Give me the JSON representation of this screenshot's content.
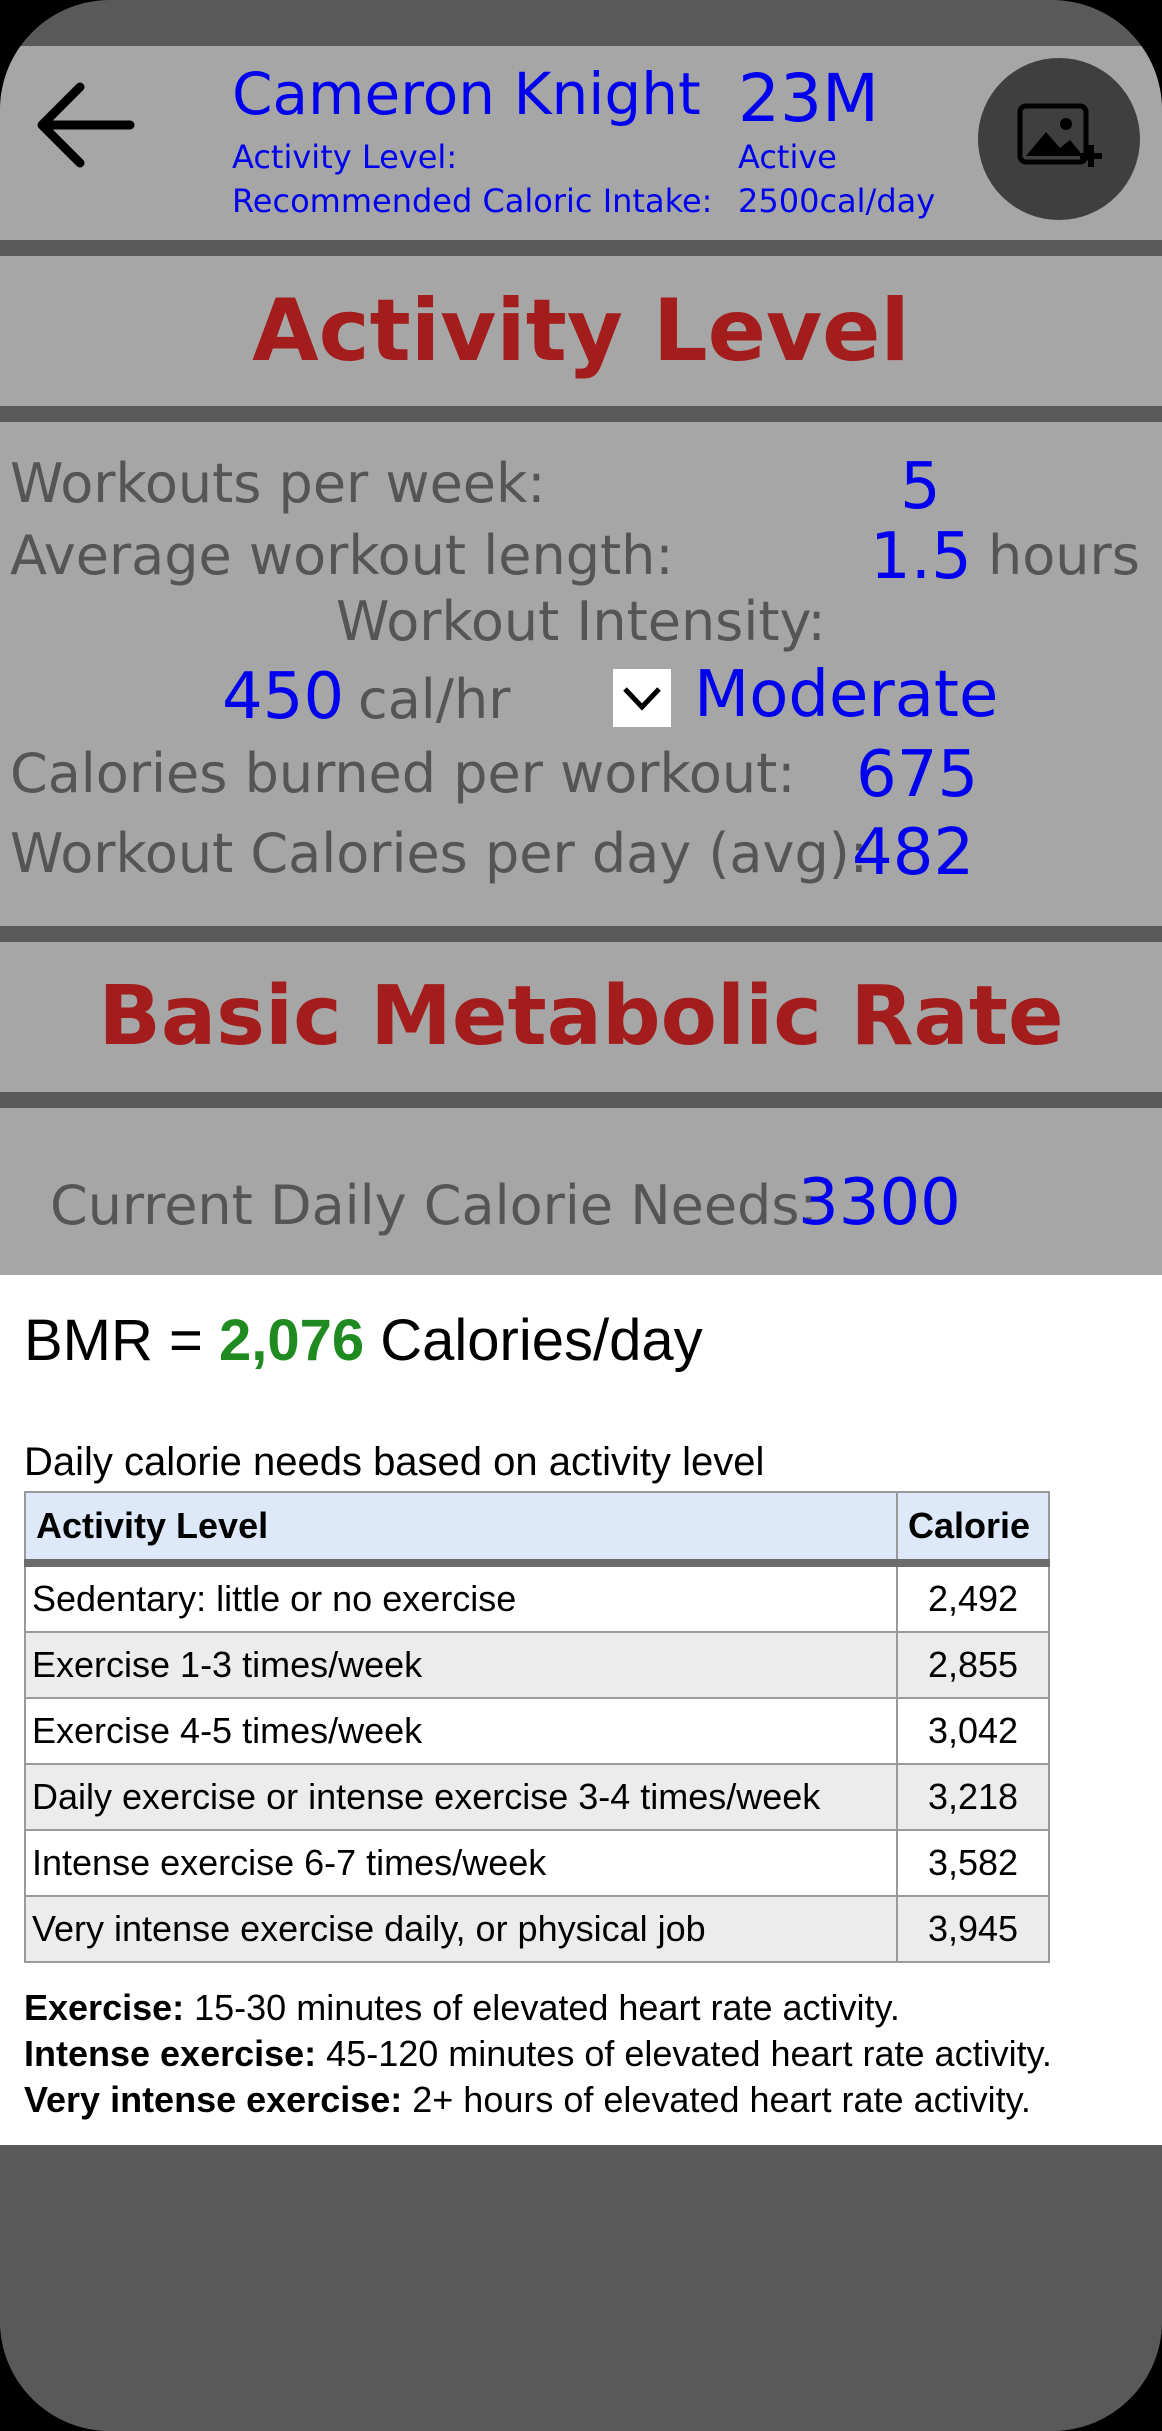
{
  "profile": {
    "name": "Cameron Knight",
    "age_sex": "23M",
    "activity_label": "Activity Level:",
    "activity_value": "Active",
    "intake_label": "Recommended Caloric Intake:",
    "intake_value": "2500cal/day"
  },
  "activity_section": {
    "title": "Activity Level",
    "workouts_label": "Workouts per week:",
    "workouts_value": "5",
    "length_label": "Average workout length:",
    "length_value": "1.5",
    "length_unit": "hours",
    "intensity_label": "Workout Intensity:",
    "intensity_rate": "450",
    "intensity_unit": "cal/hr",
    "intensity_selected": "Moderate",
    "burned_label": "Calories burned per workout:",
    "burned_value": "675",
    "daily_label": "Workout Calories per day (avg):",
    "daily_value": "482"
  },
  "bmr_section": {
    "title": "Basic Metabolic Rate",
    "needs_label": "Current Daily Calorie Needs:",
    "needs_value": "3300"
  },
  "bmr_panel": {
    "prefix": "BMR = ",
    "value": "2,076",
    "suffix": " Calories/day",
    "caption": "Daily calorie needs based on activity level",
    "columns": [
      "Activity Level",
      "Calorie"
    ],
    "rows": [
      {
        "level": "Sedentary: little or no exercise",
        "calorie": "2,492"
      },
      {
        "level": "Exercise 1-3 times/week",
        "calorie": "2,855"
      },
      {
        "level": "Exercise 4-5 times/week",
        "calorie": "3,042"
      },
      {
        "level": "Daily exercise or intense exercise 3-4 times/week",
        "calorie": "3,218"
      },
      {
        "level": "Intense exercise 6-7 times/week",
        "calorie": "3,582"
      },
      {
        "level": "Very intense exercise daily, or physical job",
        "calorie": "3,945"
      }
    ],
    "notes": [
      {
        "term": "Exercise:",
        "text": " 15-30 minutes of elevated heart rate activity."
      },
      {
        "term": "Intense exercise:",
        "text": " 45-120 minutes of elevated heart rate activity."
      },
      {
        "term": "Very intense exercise:",
        "text": " 2+ hours of elevated heart rate activity."
      }
    ]
  },
  "icons": {
    "back": "back-arrow-icon",
    "photo": "add-photo-icon",
    "dropdown": "chevron-down-icon"
  },
  "colors": {
    "title_red": "#a31d1d",
    "value_blue": "#0000ee",
    "bmr_green": "#1f8a1f",
    "band_gray": "#a6a6a6",
    "frame_gray": "#595959"
  }
}
